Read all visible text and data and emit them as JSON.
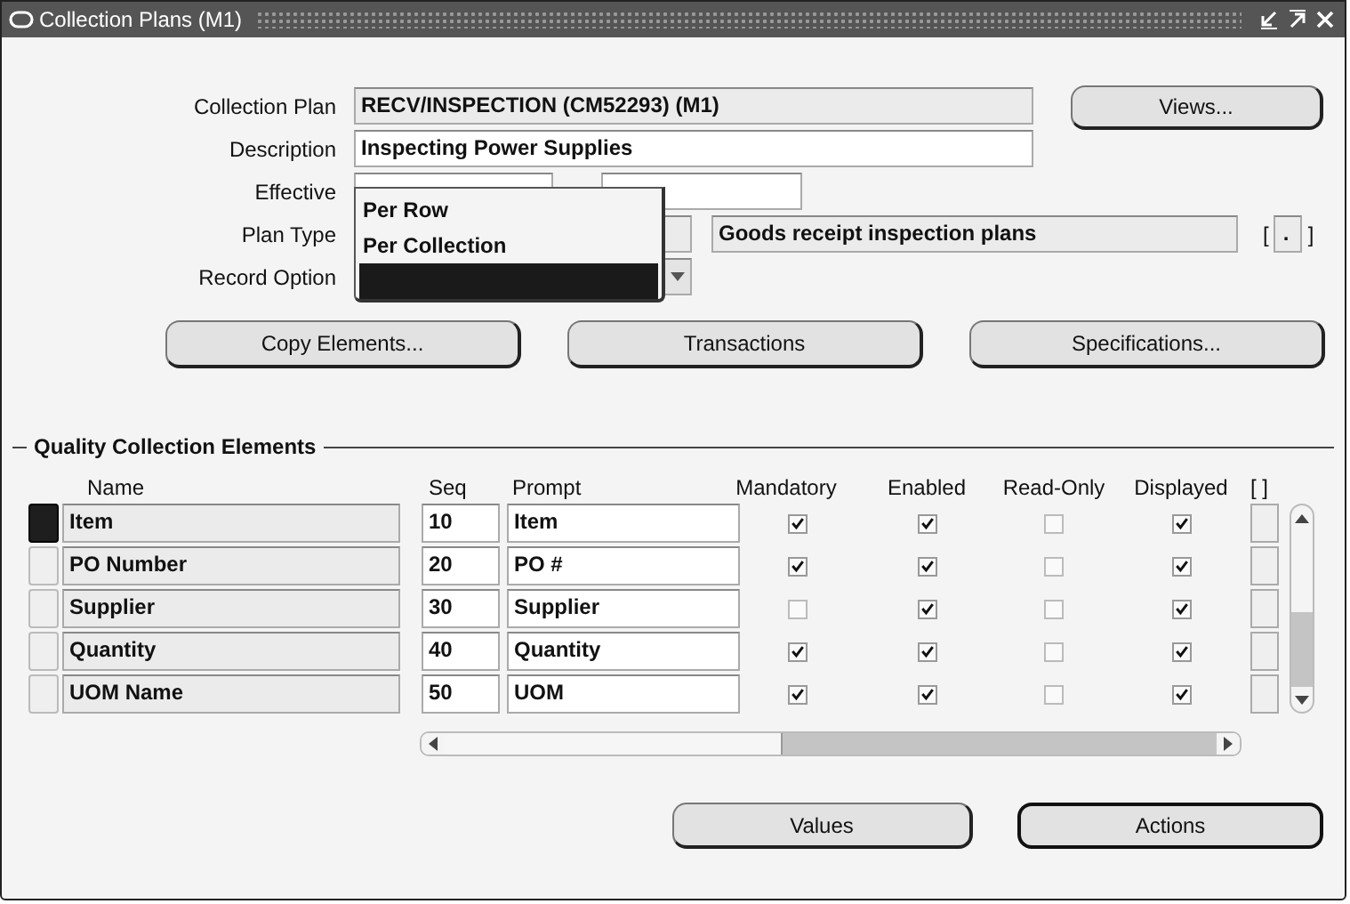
{
  "window": {
    "title": "Collection Plans (M1)"
  },
  "collection_plan": {
    "label": "Collection Plan",
    "value": "RECV/INSPECTION (CM52293) (M1)"
  },
  "views_button": "Views...",
  "description": {
    "label": "Description",
    "value": "Inspecting Power Supplies"
  },
  "effective": {
    "label": "Effective"
  },
  "plan_type": {
    "label": "Plan Type",
    "description": "Goods receipt inspection plans",
    "bracket_open": "[",
    "flex_value": ".",
    "bracket_close": "]"
  },
  "record_option": {
    "label": "Record Option",
    "options": [
      {
        "label": "Per Row",
        "selected": false
      },
      {
        "label": "Per Collection",
        "selected": false
      },
      {
        "selected": true
      }
    ]
  },
  "action_buttons": [
    "Copy Elements...",
    "Transactions",
    "Specifications..."
  ],
  "section_title": "Quality Collection Elements",
  "columns": [
    "Name",
    "Seq",
    "Prompt",
    "Mandatory",
    "Enabled",
    "Read-Only",
    "Displayed",
    "[ ]"
  ],
  "rows": [
    {
      "selected": true,
      "name": "Item",
      "seq": "10",
      "prompt": "Item",
      "mandatory": true,
      "enabled": true,
      "read_only": false,
      "displayed": true
    },
    {
      "selected": false,
      "name": "PO Number",
      "seq": "20",
      "prompt": "PO #",
      "mandatory": true,
      "enabled": true,
      "read_only": false,
      "displayed": true
    },
    {
      "selected": false,
      "name": "Supplier",
      "seq": "30",
      "prompt": "Supplier",
      "mandatory": false,
      "enabled": true,
      "read_only": false,
      "displayed": true
    },
    {
      "selected": false,
      "name": "Quantity",
      "seq": "40",
      "prompt": "Quantity",
      "mandatory": true,
      "enabled": true,
      "read_only": false,
      "displayed": true
    },
    {
      "selected": false,
      "name": "UOM Name",
      "seq": "50",
      "prompt": "UOM",
      "mandatory": true,
      "enabled": true,
      "read_only": false,
      "displayed": true
    }
  ],
  "bottom_buttons": [
    {
      "label": "Values",
      "default": false
    },
    {
      "label": "Actions",
      "default": true
    }
  ]
}
